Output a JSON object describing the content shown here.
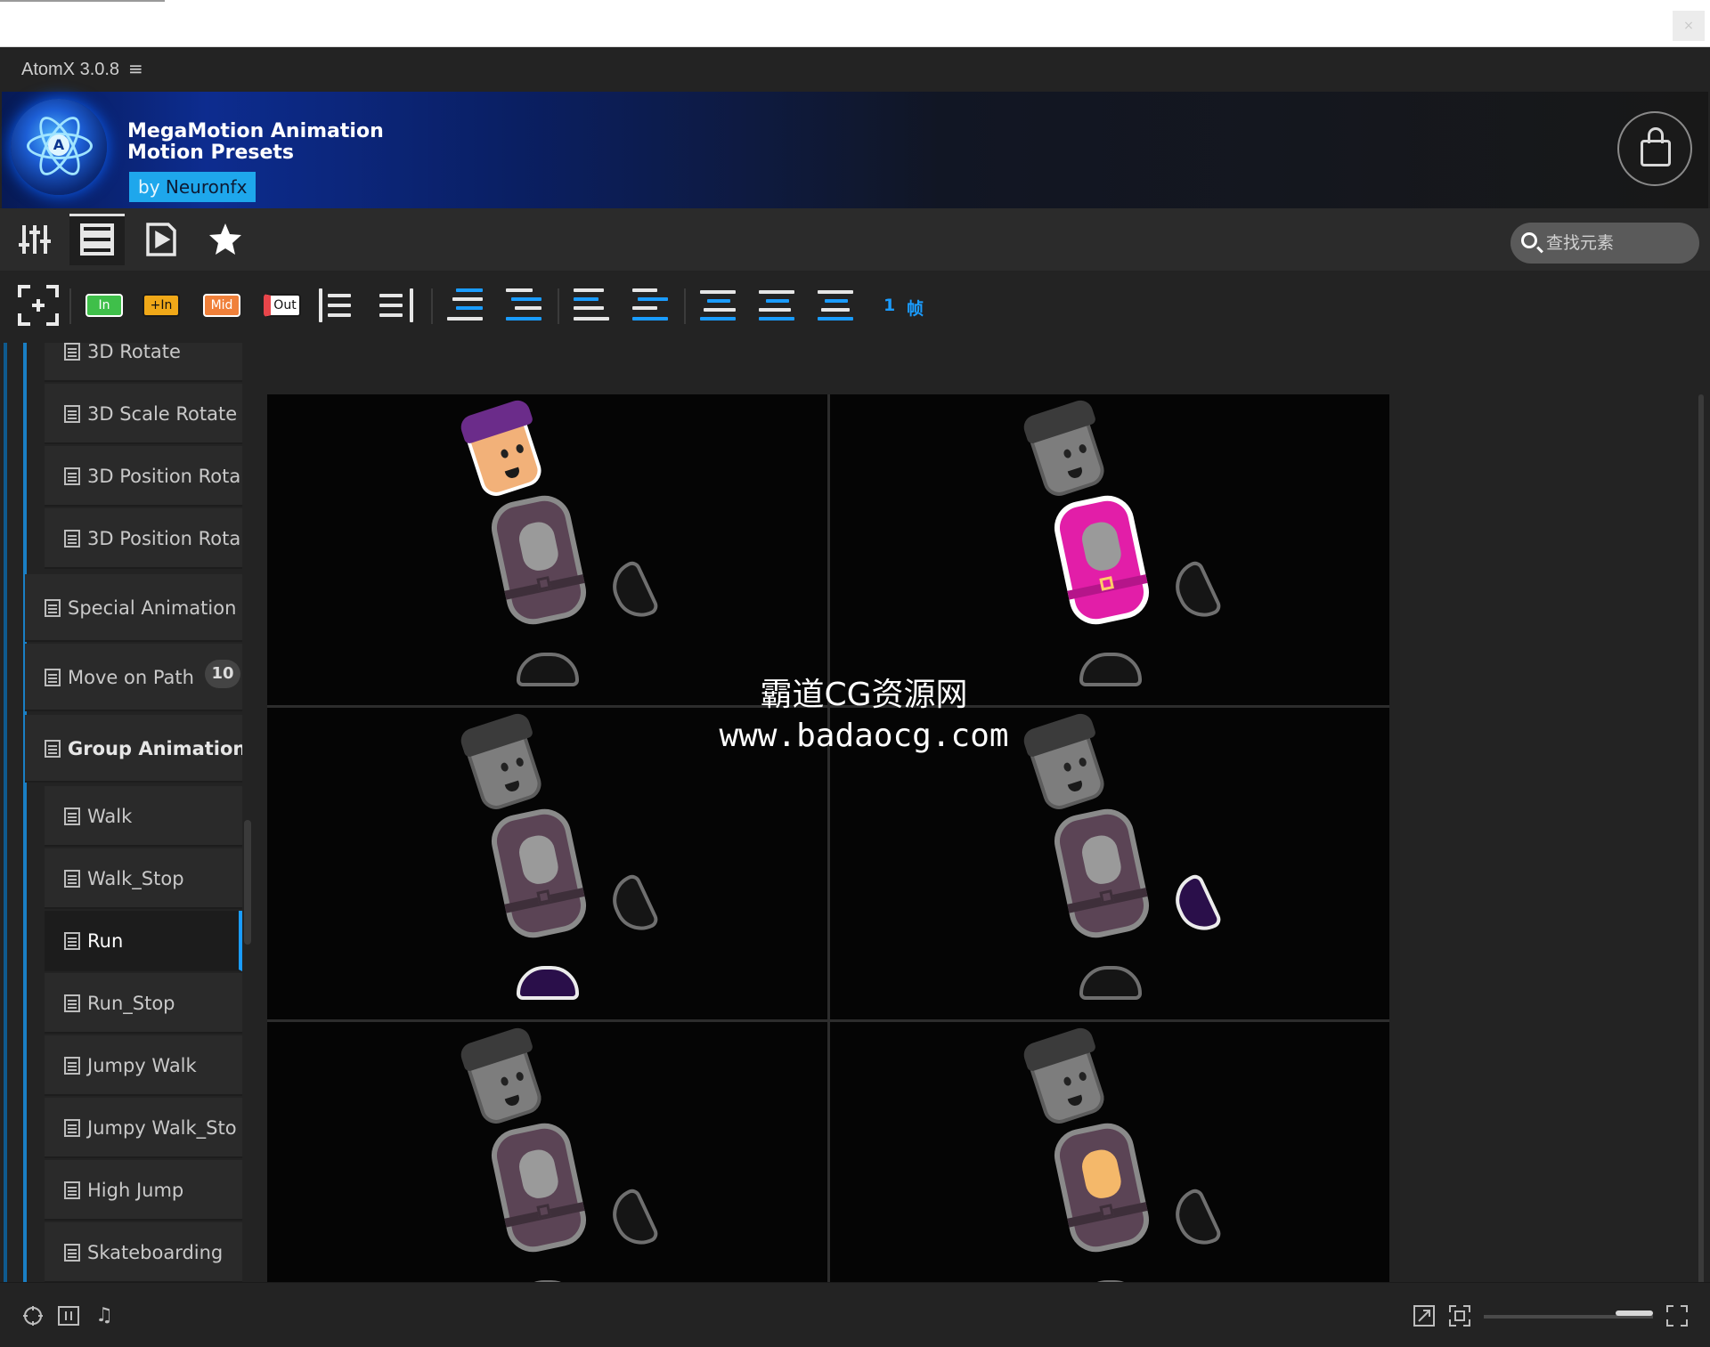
{
  "app": {
    "title": "AtomX 3.0.8",
    "menu_glyph": "≡",
    "close_glyph": "×"
  },
  "banner": {
    "title_line1": "MegaMotion Animation",
    "title_line2": "Motion Presets",
    "by": "by",
    "author": "Neuronfx",
    "logo_letter": "A",
    "accent_color": "#1ea7ec"
  },
  "nav": {
    "items": [
      {
        "name": "mixer-icon",
        "glyph": "⫼"
      },
      {
        "name": "list-icon",
        "glyph": "☰"
      },
      {
        "name": "play-file-icon",
        "glyph": "▷"
      },
      {
        "name": "star-icon",
        "glyph": "★"
      }
    ],
    "search_placeholder": "查找元素"
  },
  "toolbar": {
    "tags": [
      {
        "label": "In",
        "color": "#3fbf4a"
      },
      {
        "label": "+In",
        "color": "#f0a818"
      },
      {
        "label": "Mid",
        "color": "#f0803a"
      },
      {
        "label": "Out",
        "color": "#e8454a"
      }
    ],
    "frame_count": "1",
    "frame_unit": "帧",
    "accent_color": "#1a9cff"
  },
  "sidebar": {
    "items": [
      {
        "label": "3D Rotate",
        "type": "file"
      },
      {
        "label": "3D Scale Rotate",
        "type": "file"
      },
      {
        "label": "3D Position Rota",
        "type": "file"
      },
      {
        "label": "3D Position Rota",
        "type": "file"
      },
      {
        "label": "Special Animation",
        "type": "category"
      },
      {
        "label": "Move on Path",
        "type": "category",
        "badge": "10"
      },
      {
        "label": "Group Animations",
        "type": "category-open"
      },
      {
        "label": "Walk",
        "type": "file"
      },
      {
        "label": "Walk_Stop",
        "type": "file"
      },
      {
        "label": "Run",
        "type": "file",
        "selected": true
      },
      {
        "label": "Run_Stop",
        "type": "file"
      },
      {
        "label": "Jumpy Walk",
        "type": "file"
      },
      {
        "label": "Jumpy Walk_Sto",
        "type": "file"
      },
      {
        "label": "High Jump",
        "type": "file"
      },
      {
        "label": "Skateboarding",
        "type": "file"
      }
    ]
  },
  "preview": {
    "frames": 6,
    "highlight_colors": {
      "pink": "#e21ea8",
      "purple": "#2a0f4a",
      "skin": "#f4b86a"
    }
  },
  "watermark": {
    "line1": "霸道CG资源网",
    "line2": "www.badaocg.com"
  },
  "statusbar": {
    "left_icons": [
      "gamepad-icon",
      "pause-box-icon",
      "music-icon"
    ],
    "right_icons": [
      "expand-icon",
      "crop-icon",
      "fullscreen-icon"
    ]
  }
}
